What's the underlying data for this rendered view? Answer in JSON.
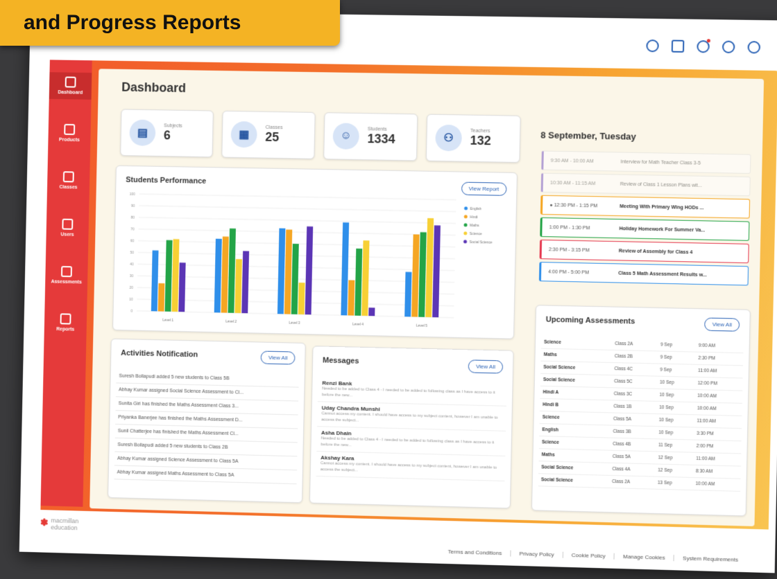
{
  "banner": "and Progress Reports",
  "sidebar": {
    "items": [
      {
        "label": "Dashboard",
        "active": true
      },
      {
        "label": "Products"
      },
      {
        "label": "Classes"
      },
      {
        "label": "Users"
      },
      {
        "label": "Assessments"
      },
      {
        "label": "Reports"
      }
    ]
  },
  "page_title": "Dashboard",
  "stats": [
    {
      "label": "Subjects",
      "value": "6",
      "icon": "book-icon"
    },
    {
      "label": "Classes",
      "value": "25",
      "icon": "presentation-icon"
    },
    {
      "label": "Students",
      "value": "1334",
      "icon": "student-icon"
    },
    {
      "label": "Teachers",
      "value": "132",
      "icon": "teachers-icon"
    }
  ],
  "performance": {
    "title": "Students Performance",
    "view_label": "View Report"
  },
  "chart_data": {
    "type": "bar",
    "categories": [
      "Level 1",
      "Level 2",
      "Level 3",
      "Level 4",
      "Level 5"
    ],
    "ylim": [
      0,
      100
    ],
    "yticks": [
      0,
      10,
      20,
      30,
      40,
      50,
      60,
      70,
      80,
      90,
      100
    ],
    "series": [
      {
        "name": "English",
        "color": "#2f8fea",
        "values": [
          52,
          63,
          73,
          79,
          38
        ]
      },
      {
        "name": "Hindi",
        "color": "#f5a623",
        "values": [
          24,
          65,
          72,
          30,
          70
        ]
      },
      {
        "name": "Maths",
        "color": "#23a447",
        "values": [
          61,
          72,
          60,
          57,
          72
        ]
      },
      {
        "name": "Science",
        "color": "#f7d035",
        "values": [
          62,
          46,
          27,
          64,
          84
        ]
      },
      {
        "name": "Social Science",
        "color": "#5b35b5",
        "values": [
          42,
          53,
          75,
          7,
          78
        ]
      }
    ]
  },
  "activities": {
    "title": "Activities Notification",
    "view_label": "View All",
    "items": [
      "Suresh Bollapudi added 5 new students to Class 5B",
      "Abhay Kumar assigned Social Science Assessment to Cl...",
      "Sunita Giri has finished the Maths Assessment Class 3...",
      "Priyanka Banerjee has finished the Maths Assessment D...",
      "Sunil Chatterjee has finished the Maths Assessment Cl...",
      "Suresh Bollapudi added 5 new students to Class 2B",
      "Abhay Kumar assigned Science Assessment to Class 5A",
      "Abhay Kumar assigned Maths Assessment to Class 5A"
    ]
  },
  "messages": {
    "title": "Messages",
    "view_label": "View All",
    "items": [
      {
        "name": "Renzi Bank",
        "text": "Needed to be added to Class 4 - I needed to be added to following class as I have access to it before the new..."
      },
      {
        "name": "Uday Chandra Munshi",
        "text": "Cannot access my content. I should have access to my subject content, however I am unable to access the subject..."
      },
      {
        "name": "Asha Dhain",
        "text": "Needed to be added to Class 4 - I needed to be added to following class as I have access to it before the new..."
      },
      {
        "name": "Akshay Kara",
        "text": "Cannot access my content. I should have access to my subject content, however I am unable to access the subject..."
      }
    ]
  },
  "schedule": {
    "date": "8 September, Tuesday",
    "events": [
      {
        "time": "9:30 AM - 10:00 AM",
        "title": "Interview for Math Teacher Class 3-5",
        "color": "#7b5cc4",
        "past": true
      },
      {
        "time": "10:30 AM - 11:15 AM",
        "title": "Review of Class 1 Lesson Plans wit...",
        "color": "#7b5cc4",
        "past": true
      },
      {
        "time": "12:30 PM - 1:15 PM",
        "title": "Meeting With Primary Wing HODs ...",
        "color": "#f5a623",
        "past": false,
        "current": true
      },
      {
        "time": "1:00 PM - 1:30 PM",
        "title": "Holiday Homework For Summer Va...",
        "color": "#23a447",
        "past": false
      },
      {
        "time": "2:30 PM - 3:15 PM",
        "title": "Review of Assembly for Class 4",
        "color": "#e53950",
        "past": false
      },
      {
        "time": "4:00 PM - 5:00 PM",
        "title": "Class 5 Math Assessment Results w...",
        "color": "#2f8fea",
        "past": false
      }
    ]
  },
  "assessments": {
    "title": "Upcoming Assessments",
    "view_label": "View All",
    "rows": [
      [
        "Science",
        "Class 2A",
        "9 Sep",
        "9:00 AM"
      ],
      [
        "Maths",
        "Class 2B",
        "9 Sep",
        "2:30 PM"
      ],
      [
        "Social Science",
        "Class 4C",
        "9 Sep",
        "11:00 AM"
      ],
      [
        "Social Science",
        "Class 5C",
        "10 Sep",
        "12:00 PM"
      ],
      [
        "Hindi A",
        "Class 3C",
        "10 Sep",
        "10:00 AM"
      ],
      [
        "Hindi B",
        "Class 1B",
        "10 Sep",
        "10:00 AM"
      ],
      [
        "Science",
        "Class 5A",
        "10 Sep",
        "11:00 AM"
      ],
      [
        "English",
        "Class 3B",
        "10 Sep",
        "3:30 PM"
      ],
      [
        "Science",
        "Class 4B",
        "11 Sep",
        "2:00 PM"
      ],
      [
        "Maths",
        "Class 5A",
        "12 Sep",
        "11:00 AM"
      ],
      [
        "Social Science",
        "Class 4A",
        "12 Sep",
        "8:30 AM"
      ],
      [
        "Social Science",
        "Class 2A",
        "13 Sep",
        "10:00 AM"
      ]
    ]
  },
  "footer": {
    "logo_top": "macmillan",
    "logo_bottom": "education",
    "links": [
      "Terms and Conditions",
      "Privacy Policy",
      "Cookie Policy",
      "Manage Cookies",
      "System Requirements"
    ]
  }
}
